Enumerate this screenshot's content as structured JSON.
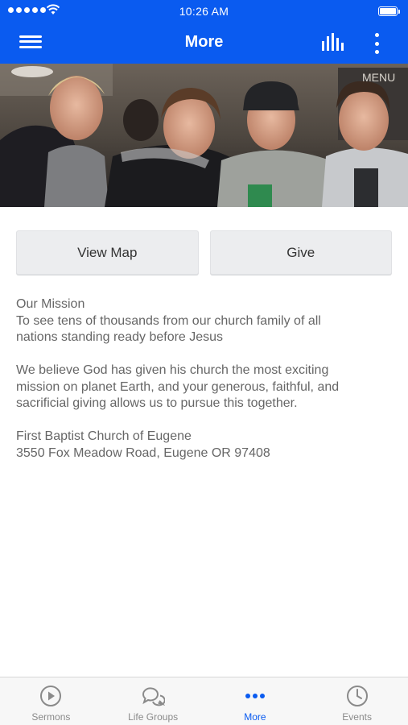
{
  "status_bar": {
    "time": "10:26 AM"
  },
  "nav": {
    "title": "More"
  },
  "hero": {
    "alt": "Four young men smiling together"
  },
  "buttons": {
    "view_map": "View Map",
    "give": "Give"
  },
  "mission": {
    "heading": "Our Mission",
    "line1": "To see tens of thousands from our church family of all",
    "line2": "nations standing ready before Jesus"
  },
  "belief": {
    "line1": "We believe God has given his church the most exciting",
    "line2": "mission on planet Earth, and your generous, faithful, and",
    "line3": "sacrificial giving allows us to pursue this together."
  },
  "address": {
    "name": "First Baptist Church of Eugene",
    "street": "3550 Fox Meadow Road, Eugene OR 97408"
  },
  "tabs": [
    {
      "label": "Sermons",
      "icon": "play-circle-icon",
      "active": false
    },
    {
      "label": "Life Groups",
      "icon": "chat-bubbles-icon",
      "active": false
    },
    {
      "label": "More",
      "icon": "more-dots-icon",
      "active": true
    },
    {
      "label": "Events",
      "icon": "clock-icon",
      "active": false
    }
  ],
  "colors": {
    "brand": "#0a5bf0",
    "tab_inactive": "#8a8a8a",
    "text": "#666666"
  }
}
